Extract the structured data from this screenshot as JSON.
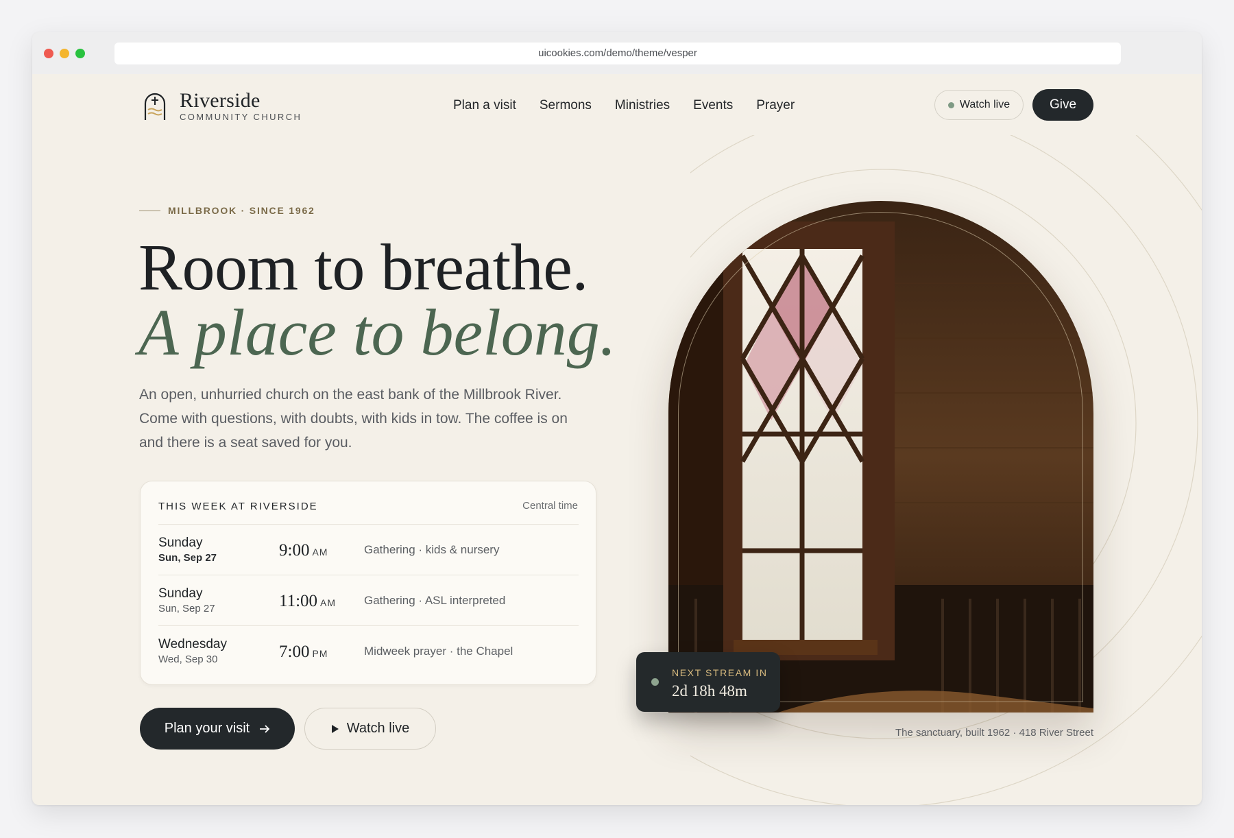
{
  "browser": {
    "url": "uicookies.com/demo/theme/vesper"
  },
  "header": {
    "brand_name": "Riverside",
    "brand_sub": "COMMUNITY CHURCH",
    "nav": [
      "Plan a visit",
      "Sermons",
      "Ministries",
      "Events",
      "Prayer"
    ],
    "watch_live": "Watch live",
    "give": "Give"
  },
  "hero": {
    "eyebrow": "MILLBROOK · SINCE 1962",
    "headline_line1": "Room to breathe.",
    "headline_line2": "A place to belong.",
    "intro": "An open, unhurried church on the east bank of the Millbrook River. Come with questions, with doubts, with kids in tow. The coffee is on and there is a seat saved for you."
  },
  "schedule": {
    "title": "THIS WEEK AT RIVERSIDE",
    "timezone": "Central time",
    "rows": [
      {
        "day": "Sunday",
        "date": "Sun, Sep 27",
        "time": "9:00",
        "ampm": "AM",
        "desc": "Gathering · kids & nursery"
      },
      {
        "day": "Sunday",
        "date": "Sun, Sep 27",
        "time": "11:00",
        "ampm": "AM",
        "desc": "Gathering · ASL interpreted"
      },
      {
        "day": "Wednesday",
        "date": "Wed, Sep 30",
        "time": "7:00",
        "ampm": "PM",
        "desc": "Midweek prayer · the Chapel"
      }
    ]
  },
  "cta": {
    "plan_visit": "Plan your visit",
    "watch_live": "Watch live"
  },
  "stream": {
    "label": "NEXT STREAM IN",
    "countdown": "2d 18h 48m"
  },
  "photo_caption": "The sanctuary, built 1962 · 418 River Street",
  "colors": {
    "background": "#f4f0e8",
    "dark": "#23282b",
    "accent_green": "#4c6651",
    "accent_gold": "#d6b97e"
  }
}
